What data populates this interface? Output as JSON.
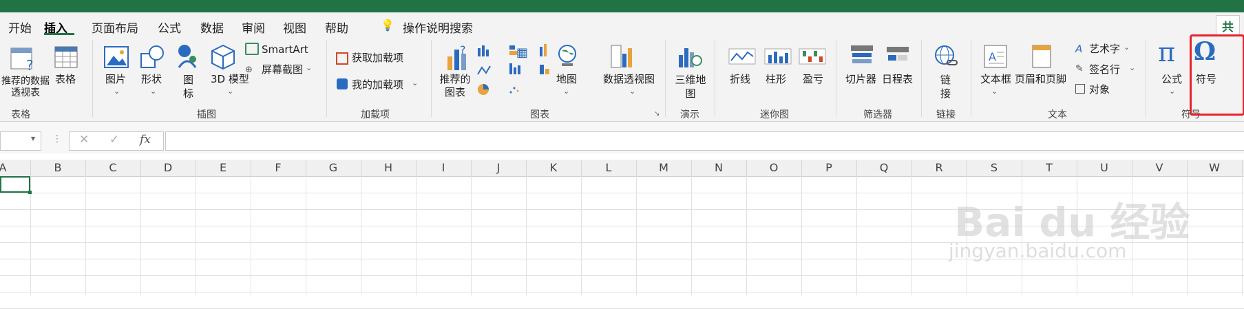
{
  "tabs": [
    "开始",
    "插入",
    "页面布局",
    "公式",
    "数据",
    "审阅",
    "视图",
    "帮助"
  ],
  "search": {
    "label": "操作说明搜索"
  },
  "share": {
    "label": "共"
  },
  "ribbon": {
    "tables": {
      "recommended_pivot": "推荐的数据透视表",
      "table": "表格",
      "group": "表格"
    },
    "illustrations": {
      "pictures": "图片",
      "shapes": "形状",
      "icons": "图标",
      "model3d": "3D 模型",
      "smartart": "SmartArt",
      "screenshot": "屏幕截图",
      "group": "插图"
    },
    "addins": {
      "get_addins": "获取加载项",
      "my_addins": "我的加载项",
      "group": "加载项"
    },
    "charts": {
      "recommended": "推荐的图表",
      "maps": "地图",
      "pivot_chart": "数据透视图",
      "group": "图表"
    },
    "tours": {
      "map3d": "三维地图",
      "group": "演示"
    },
    "sparklines": {
      "line": "折线",
      "column": "柱形",
      "winloss": "盈亏",
      "group": "迷你图"
    },
    "filters": {
      "slicer": "切片器",
      "timeline": "日程表",
      "group": "筛选器"
    },
    "links": {
      "link": "链接",
      "group": "链接"
    },
    "text": {
      "textbox": "文本框",
      "header_footer": "页眉和页脚",
      "wordart": "艺术字",
      "signature": "签名行",
      "object": "对象",
      "group": "文本"
    },
    "symbols": {
      "equation": "公式",
      "symbol": "符号",
      "group": "符号"
    }
  },
  "formula_bar": {
    "fx": "fx",
    "cancel": "✕",
    "enter": "✓",
    "value": ""
  },
  "columns": [
    "A",
    "B",
    "C",
    "D",
    "E",
    "F",
    "G",
    "H",
    "I",
    "J",
    "K",
    "L",
    "M",
    "N",
    "O",
    "P",
    "Q",
    "R",
    "S",
    "T",
    "U",
    "V",
    "W"
  ],
  "watermark": {
    "brand": "Bai du 经验",
    "url": "jingyan.baidu.com"
  },
  "colors": {
    "excel_green": "#217346",
    "highlight": "#e8212a",
    "symbol_blue": "#2b6bbf"
  }
}
